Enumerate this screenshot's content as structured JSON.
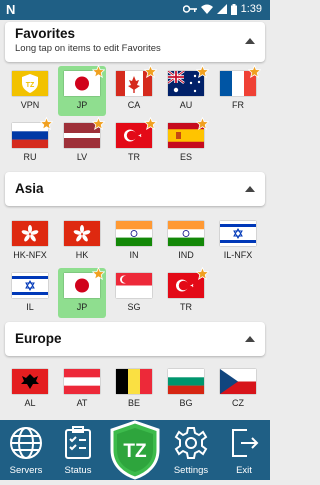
{
  "status": {
    "time": "1:39",
    "left_icon": "n-icon"
  },
  "favorites": {
    "title": "Favorites",
    "subtitle": "Long tap on items to edit Favorites",
    "items": [
      {
        "label": "VPN",
        "flag": "vpn",
        "selected": false,
        "star": false
      },
      {
        "label": "JP",
        "flag": "jp",
        "selected": true,
        "star": true
      },
      {
        "label": "CA",
        "flag": "ca",
        "selected": false,
        "star": true
      },
      {
        "label": "AU",
        "flag": "au",
        "selected": false,
        "star": true
      },
      {
        "label": "FR",
        "flag": "fr",
        "selected": false,
        "star": true
      },
      {
        "label": "RU",
        "flag": "ru",
        "selected": false,
        "star": true
      },
      {
        "label": "LV",
        "flag": "lv",
        "selected": false,
        "star": true
      },
      {
        "label": "TR",
        "flag": "tr",
        "selected": false,
        "star": true
      },
      {
        "label": "ES",
        "flag": "es",
        "selected": false,
        "star": true
      }
    ]
  },
  "asia": {
    "title": "Asia",
    "items": [
      {
        "label": "HK-NFX",
        "flag": "hk",
        "selected": false,
        "star": false
      },
      {
        "label": "HK",
        "flag": "hk",
        "selected": false,
        "star": false
      },
      {
        "label": "IN",
        "flag": "in",
        "selected": false,
        "star": false
      },
      {
        "label": "IND",
        "flag": "in",
        "selected": false,
        "star": false
      },
      {
        "label": "IL-NFX",
        "flag": "il",
        "selected": false,
        "star": false
      },
      {
        "label": "IL",
        "flag": "il",
        "selected": false,
        "star": false
      },
      {
        "label": "JP",
        "flag": "jp",
        "selected": true,
        "star": true
      },
      {
        "label": "SG",
        "flag": "sg",
        "selected": false,
        "star": false
      },
      {
        "label": "TR",
        "flag": "tr",
        "selected": false,
        "star": true
      }
    ]
  },
  "europe": {
    "title": "Europe",
    "items": [
      {
        "label": "AL",
        "flag": "al",
        "selected": false,
        "star": false
      },
      {
        "label": "AT",
        "flag": "at",
        "selected": false,
        "star": false
      },
      {
        "label": "BE",
        "flag": "be",
        "selected": false,
        "star": false
      },
      {
        "label": "BG",
        "flag": "bg",
        "selected": false,
        "star": false
      },
      {
        "label": "CZ",
        "flag": "cz",
        "selected": false,
        "star": false
      }
    ]
  },
  "nav": {
    "servers": "Servers",
    "status": "Status",
    "logo": "TZ",
    "settings": "Settings",
    "exit": "Exit"
  },
  "colors": {
    "bar": "#1f5f85",
    "selected": "#8fde8f",
    "star": "#f0a020"
  }
}
